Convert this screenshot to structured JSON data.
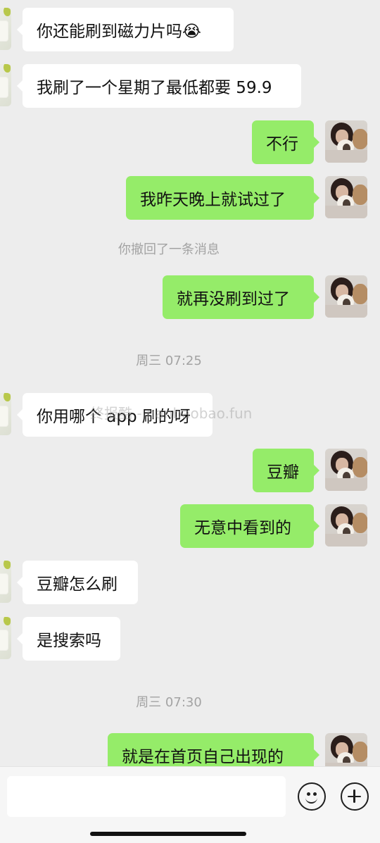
{
  "conversation": {
    "messages": [
      {
        "side": "left",
        "text": "你还能刷到磁力片吗😭"
      },
      {
        "side": "left",
        "text": "我刷了一个星期了最低都要 59.9"
      },
      {
        "side": "right",
        "text": "不行"
      },
      {
        "side": "right",
        "text": "我昨天晚上就试过了"
      },
      {
        "side": "system",
        "text": "你撤回了一条消息"
      },
      {
        "side": "right",
        "text": "就再没刷到过了"
      },
      {
        "side": "time",
        "text": "周三 07:25"
      },
      {
        "side": "left",
        "text": "你用哪个 app 刷的呀"
      },
      {
        "side": "right",
        "text": "豆瓣"
      },
      {
        "side": "right",
        "text": "无意中看到的"
      },
      {
        "side": "left",
        "text": "豆瓣怎么刷"
      },
      {
        "side": "left",
        "text": "是搜索吗"
      },
      {
        "side": "time",
        "text": "周三 07:30"
      },
      {
        "side": "right",
        "text": "就是在首页自己出现的"
      }
    ]
  },
  "watermark": {
    "text": "终报酷 - nanbaobao.fun"
  },
  "composer": {
    "input_value": "",
    "emoji_icon": "emoji-icon",
    "plus_icon": "plus-icon"
  }
}
